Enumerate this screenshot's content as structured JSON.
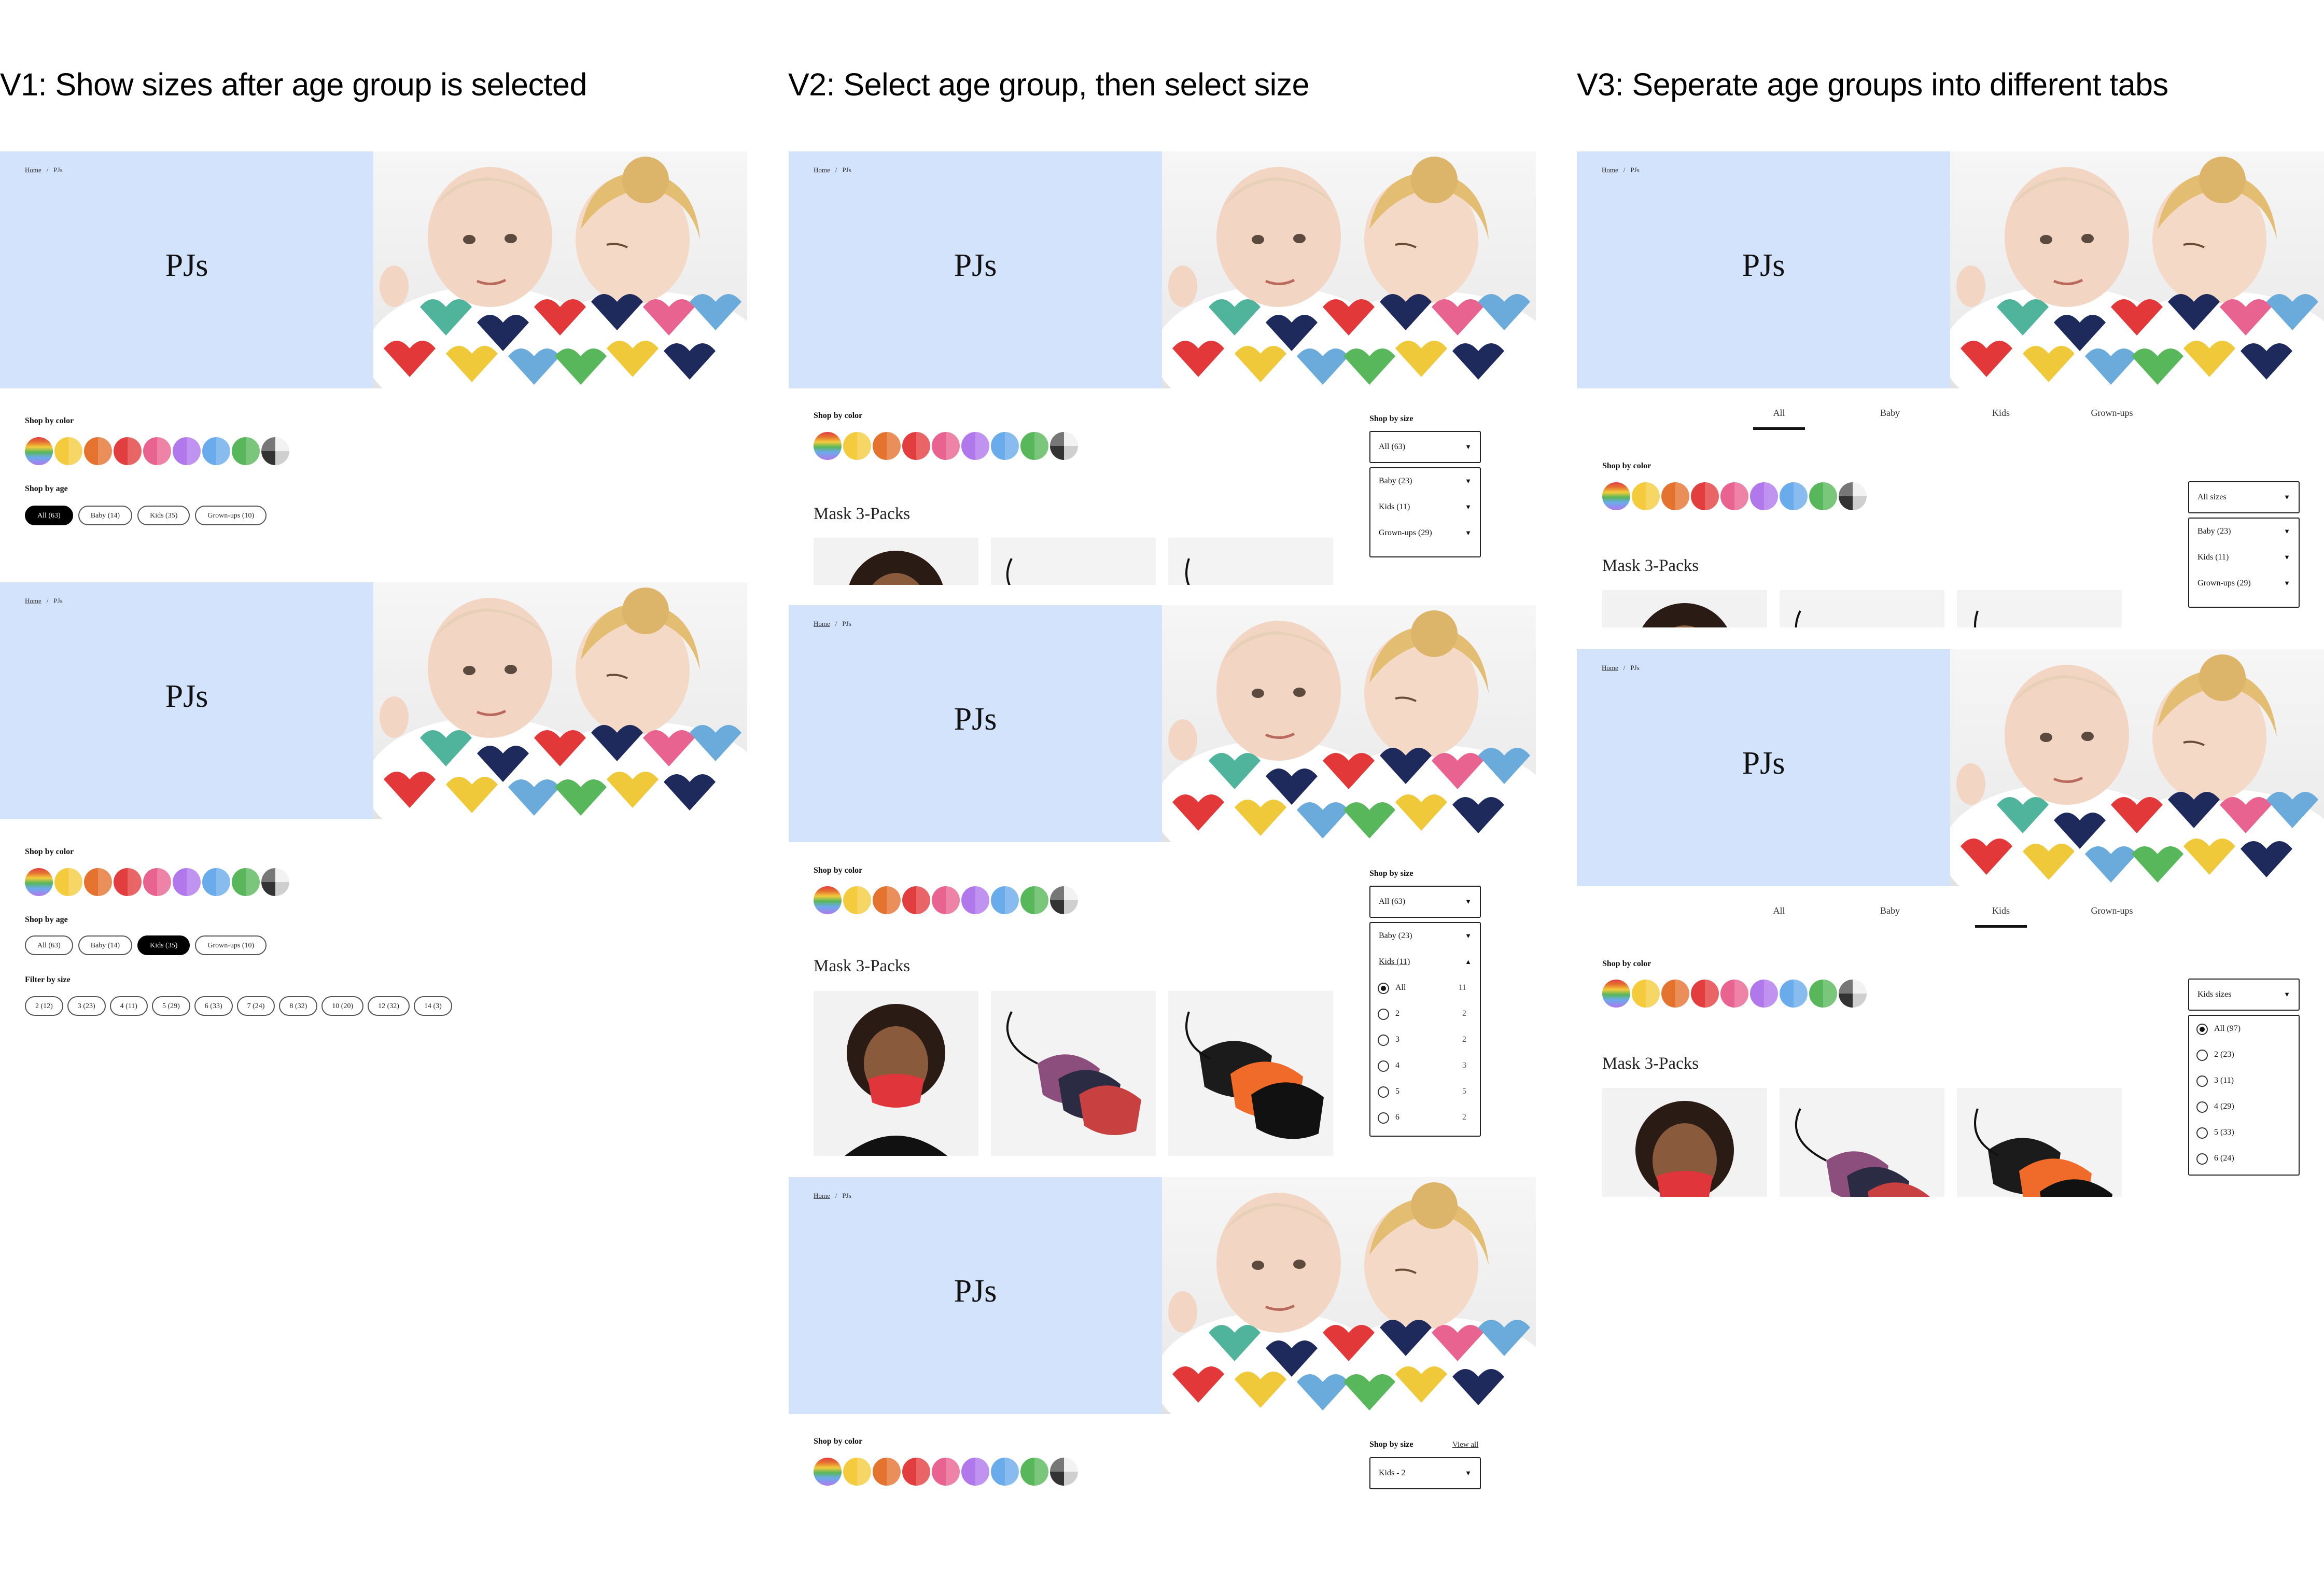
{
  "headings": {
    "v1": "V1: Show sizes after age group is selected",
    "v2": "V2: Select age group, then select size",
    "v3": "V3: Seperate age groups into different tabs"
  },
  "hero": {
    "crumb_home": "Home",
    "crumb_sep": "/",
    "crumb_current": "PJs",
    "title": "PJs"
  },
  "labels": {
    "shop_by_color": "Shop by color",
    "shop_by_age": "Shop by age",
    "filter_by_size": "Filter by size",
    "shop_by_size": "Shop by size",
    "view_all": "View all",
    "mask_packs": "Mask 3-Packs"
  },
  "swatch_colors": [
    "rainbow",
    "#f3cb3d",
    "#e57330",
    "#e33e3f",
    "#e96391",
    "#b178ec",
    "#6aabeb",
    "#58b75a",
    "mono"
  ],
  "age_pills": [
    "All (63)",
    "Baby (14)",
    "Kids (35)",
    "Grown-ups (10)"
  ],
  "size_pills": [
    "2 (12)",
    "3 (23)",
    "4 (11)",
    "5 (29)",
    "6 (33)",
    "7 (24)",
    "8 (32)",
    "10 (20)",
    "12 (32)",
    "14 (3)"
  ],
  "v2": {
    "select_all": "All (63)",
    "groups": [
      "Baby (23)",
      "Kids (11)",
      "Grown-ups (29)"
    ],
    "kids_sizes": [
      {
        "label": "All",
        "count": "11"
      },
      {
        "label": "2",
        "count": "2"
      },
      {
        "label": "3",
        "count": "2"
      },
      {
        "label": "4",
        "count": "3"
      },
      {
        "label": "5",
        "count": "5"
      },
      {
        "label": "6",
        "count": "2"
      }
    ],
    "select_kids2": "Kids - 2"
  },
  "v3": {
    "tabs": [
      "All",
      "Baby",
      "Kids",
      "Grown-ups"
    ],
    "select_all_sizes": "All sizes",
    "groups": [
      "Baby (23)",
      "Kids (11)",
      "Grown-ups (29)"
    ],
    "select_kids_sizes": "Kids sizes",
    "kids_sizes": [
      "All (97)",
      "2 (23)",
      "3 (11)",
      "4 (29)",
      "5 (33)",
      "6 (24)"
    ]
  }
}
